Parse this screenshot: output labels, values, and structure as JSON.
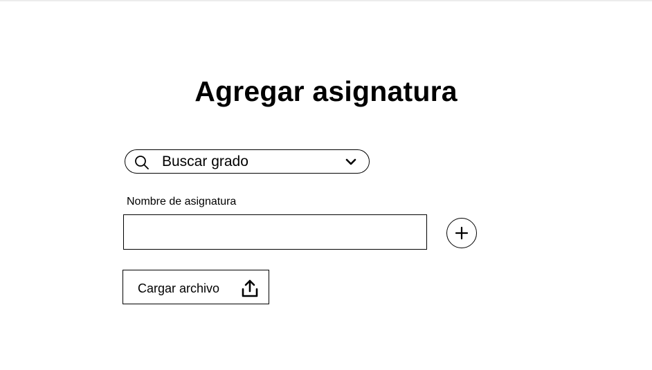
{
  "page": {
    "title": "Agregar asignatura"
  },
  "grade_select": {
    "value": "Buscar grado",
    "icon": "search-icon",
    "dropdown_icon": "chevron-down-icon"
  },
  "subject_field": {
    "label": "Nombre de asignatura",
    "value": "",
    "placeholder": ""
  },
  "add_button": {
    "icon": "plus-icon"
  },
  "upload": {
    "label": "Cargar archivo",
    "icon": "upload-icon"
  }
}
